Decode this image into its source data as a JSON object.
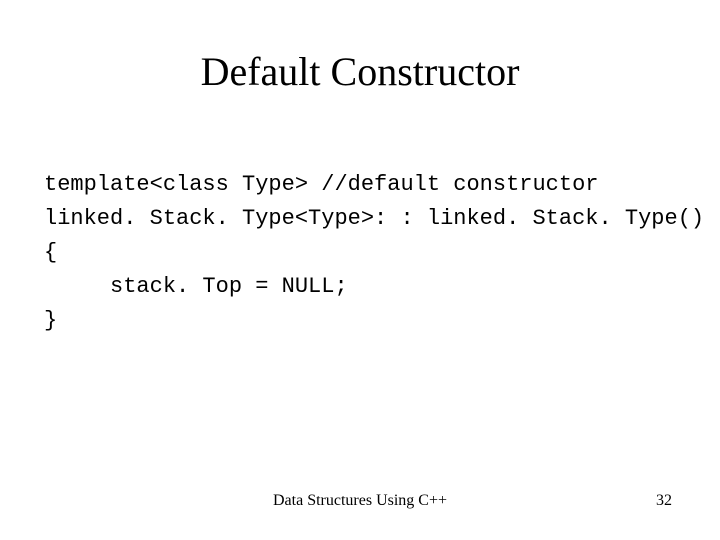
{
  "title": "Default Constructor",
  "code": {
    "line1": "template<class Type> //default constructor",
    "line2": "linked. Stack. Type<Type>: : linked. Stack. Type()",
    "line3": "{",
    "line4": "     stack. Top = NULL;",
    "line5": "}"
  },
  "footer": {
    "center": "Data Structures Using C++",
    "page": "32"
  }
}
